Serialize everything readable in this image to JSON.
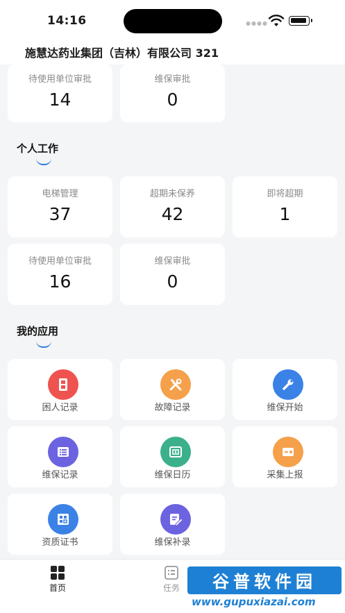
{
  "status_bar": {
    "time": "14:16"
  },
  "header": {
    "title": "施慧达药业集团（吉林）有限公司 321"
  },
  "top_stats": [
    {
      "label": "待使用单位审批",
      "value": "14"
    },
    {
      "label": "维保审批",
      "value": "0"
    }
  ],
  "personal": {
    "title": "个人工作",
    "stats": [
      {
        "label": "电梯管理",
        "value": "37"
      },
      {
        "label": "超期未保养",
        "value": "42"
      },
      {
        "label": "即将超期",
        "value": "1"
      },
      {
        "label": "待使用单位审批",
        "value": "16"
      },
      {
        "label": "维保审批",
        "value": "0"
      }
    ]
  },
  "apps": {
    "title": "我的应用",
    "items": [
      {
        "label": "困人记录",
        "icon": "elevator-icon",
        "color": "#ef5350"
      },
      {
        "label": "故障记录",
        "icon": "tools-icon",
        "color": "#f5a04a"
      },
      {
        "label": "维保开始",
        "icon": "wrench-icon",
        "color": "#3b82e6"
      },
      {
        "label": "维保记录",
        "icon": "list-icon",
        "color": "#6c63e0"
      },
      {
        "label": "维保日历",
        "icon": "calendar-icon",
        "color": "#3cb08a"
      },
      {
        "label": "采集上报",
        "icon": "upload-icon",
        "color": "#f5a04a"
      },
      {
        "label": "资质证书",
        "icon": "certificate-icon",
        "color": "#3b82e6"
      },
      {
        "label": "维保补录",
        "icon": "edit-icon",
        "color": "#6c63e0"
      }
    ]
  },
  "tabbar": {
    "home": "首页",
    "tasks": "任务"
  },
  "watermark": {
    "title": "谷普软件园",
    "url": "www.gupuxiazai.com"
  },
  "colors": {
    "accent": "#2e7be6",
    "background": "#f4f5f7",
    "card": "#ffffff"
  }
}
